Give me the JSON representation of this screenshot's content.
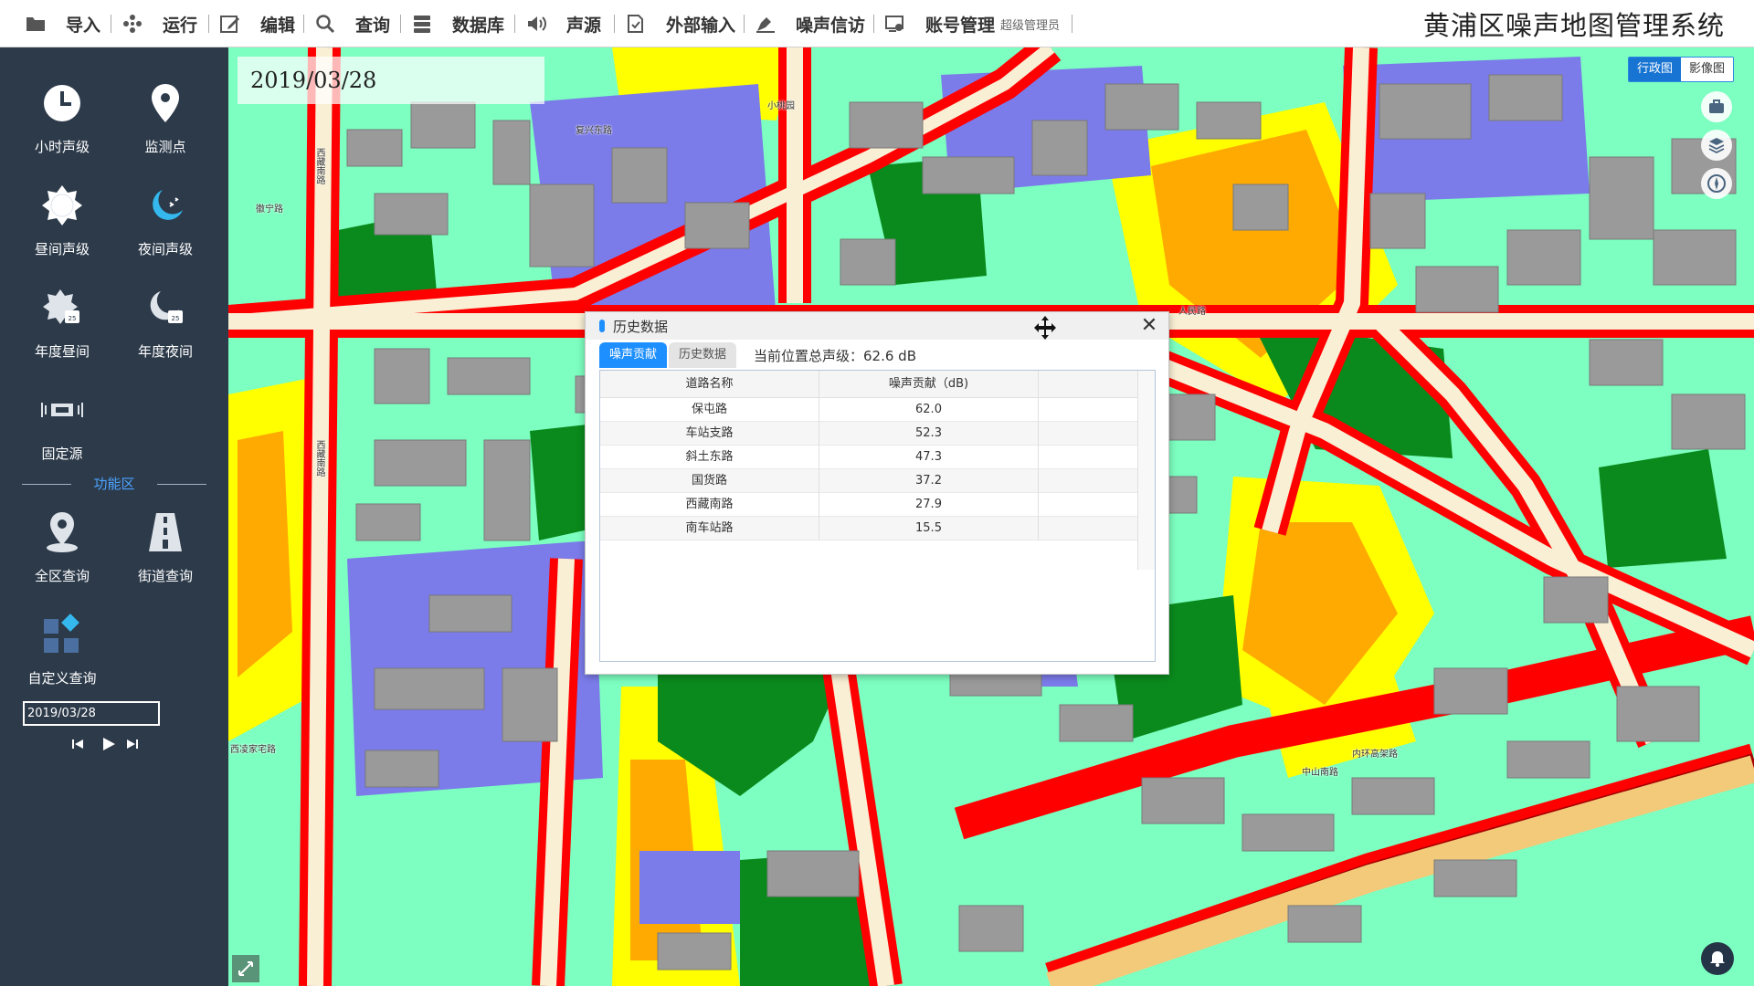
{
  "app_title": "黄浦区噪声地图管理系统",
  "toolbar": {
    "items": [
      {
        "label": "导入",
        "icon": "folder-icon"
      },
      {
        "label": "运行",
        "icon": "run-icon"
      },
      {
        "label": "编辑",
        "icon": "edit-icon"
      },
      {
        "label": "查询",
        "icon": "search-icon"
      },
      {
        "label": "数据库",
        "icon": "database-icon"
      },
      {
        "label": "声源",
        "icon": "speaker-icon"
      },
      {
        "label": "外部输入",
        "icon": "document-input-icon"
      },
      {
        "label": "噪声信访",
        "icon": "complaint-icon"
      },
      {
        "label": "账号管理",
        "icon": "account-icon"
      }
    ],
    "role": "超级管理员"
  },
  "sidebar": {
    "buttons": [
      {
        "label": "小时声级",
        "icon": "clock-icon"
      },
      {
        "label": "监测点",
        "icon": "location-pin-icon"
      },
      {
        "label": "昼间声级",
        "icon": "sun-icon"
      },
      {
        "label": "夜间声级",
        "icon": "moon-icon"
      },
      {
        "label": "年度昼间",
        "icon": "sun-calendar-icon"
      },
      {
        "label": "年度夜间",
        "icon": "moon-calendar-icon"
      },
      {
        "label": "固定源",
        "icon": "fixed-source-icon"
      }
    ],
    "func_title": "功能区",
    "func_buttons": [
      {
        "label": "全区查询",
        "icon": "district-pin-icon"
      },
      {
        "label": "街道查询",
        "icon": "street-icon"
      },
      {
        "label": "自定义查询",
        "icon": "custom-grid-icon"
      }
    ],
    "date_value": "2019/03/28"
  },
  "map": {
    "date": "2019/03/28",
    "maptype": {
      "active": "行政图",
      "inactive": "影像图"
    },
    "road_labels": [
      "西藏南路",
      "西藏南路",
      "复兴东路",
      "人民路",
      "中山南路",
      "内环高架路",
      "西凌家宅路",
      "徽宁路",
      "小桃园"
    ]
  },
  "dialog": {
    "title": "历史数据",
    "tabs": [
      "噪声贡献",
      "历史数据"
    ],
    "total_label": "当前位置总声级：62.6 dB",
    "columns": [
      "道路名称",
      "噪声贡献（dB)"
    ],
    "rows": [
      {
        "road": "保屯路",
        "value": "62.0"
      },
      {
        "road": "车站支路",
        "value": "52.3"
      },
      {
        "road": "斜土东路",
        "value": "47.3"
      },
      {
        "road": "国货路",
        "value": "37.2"
      },
      {
        "road": "西藏南路",
        "value": "27.9"
      },
      {
        "road": "南车站路",
        "value": "15.5"
      }
    ]
  },
  "colors": {
    "accent": "#1e8fff",
    "sidebar": "#2c3a4a",
    "noise_level_1": "#7cffc0",
    "noise_level_2": "#0a8a1c",
    "noise_level_3": "#ffff00",
    "noise_level_4": "#ffaa00",
    "noise_level_5": "#ff0000",
    "noise_level_6": "#a40000",
    "building": "#9a9a9a",
    "building_blue": "#7b7bea"
  }
}
